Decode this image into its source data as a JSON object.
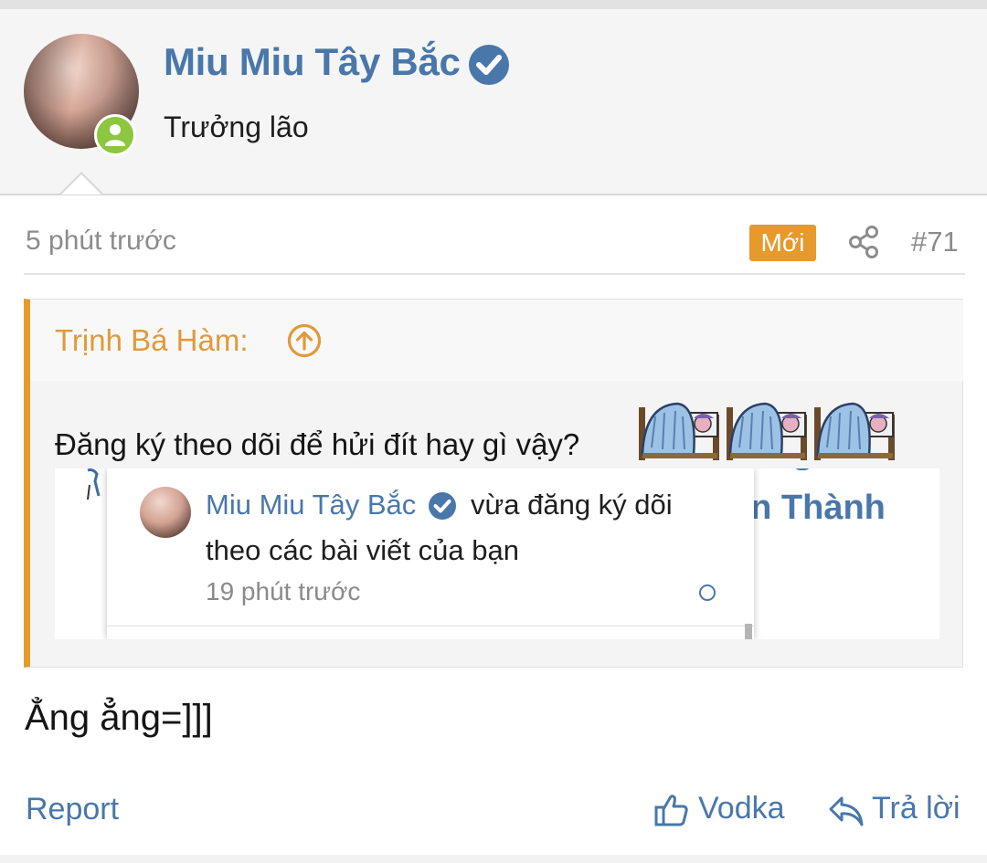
{
  "user": {
    "name": "Miu Miu Tây Bắc",
    "title": "Trưởng lão",
    "verified": true,
    "online": true,
    "icons": {
      "verified": "verified-check-icon",
      "online": "online-user-icon"
    }
  },
  "post": {
    "time": "5 phút trước",
    "new_badge": "Mới",
    "number": "#71",
    "body": "Ẳng ẳng=]]]",
    "icons": {
      "share": "share-icon"
    }
  },
  "quote": {
    "author": "Trịnh Bá Hàm:",
    "text": "Đăng ký theo dõi để hửi đít hay gì vậy?",
    "emoji": "sleeping-in-bed-emoji",
    "icons": {
      "jump": "arrow-up-circle-icon"
    }
  },
  "screenshot": {
    "partial_text": "ện Thành",
    "notification": {
      "name": "Miu Miu Tây Bắc",
      "action_line1": "vừa đăng ký dõi",
      "action_line2": "theo các bài viết của bạn",
      "time": "19 phút trước"
    }
  },
  "actions": {
    "report": "Report",
    "like": "Vodka",
    "reply": "Trả lời",
    "icons": {
      "like": "thumbs-up-icon",
      "reply": "reply-arrow-icon"
    }
  },
  "colors": {
    "link": "#4a77aa",
    "accent": "#e69a2c",
    "online": "#8dc63f",
    "muted": "#8c8c8c"
  }
}
